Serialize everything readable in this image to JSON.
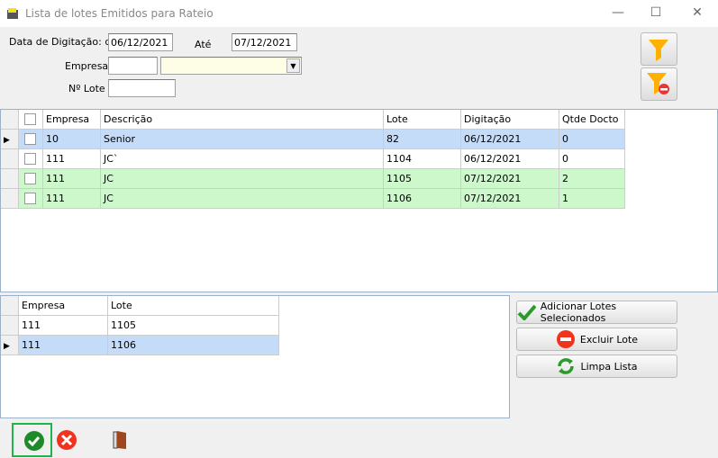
{
  "window": {
    "title": "Lista de lotes Emitidos para Rateio"
  },
  "filters": {
    "date_label": "Data de Digitação: de",
    "date_from": "06/12/2021",
    "ate_label": "Até",
    "date_to": "07/12/2021",
    "empresa_label": "Empresa",
    "empresa_code": "",
    "empresa_name": "",
    "lote_label": "Nº Lote",
    "lote_value": ""
  },
  "grid1": {
    "columns": [
      "Empresa",
      "Descrição",
      "Lote",
      "Digitação",
      "Qtde Docto"
    ],
    "rows": [
      {
        "empresa": "10",
        "descricao": "Senior",
        "lote": "82",
        "digitacao": "06/12/2021",
        "qtde": "0",
        "color": "#c5dcf8",
        "current": true
      },
      {
        "empresa": "111",
        "descricao": "JC`",
        "lote": "1104",
        "digitacao": "06/12/2021",
        "qtde": "0",
        "color": "#ffffff",
        "current": false
      },
      {
        "empresa": "111",
        "descricao": "JC",
        "lote": "1105",
        "digitacao": "07/12/2021",
        "qtde": "2",
        "color": "#ccf8cc",
        "current": false
      },
      {
        "empresa": "111",
        "descricao": "JC",
        "lote": "1106",
        "digitacao": "07/12/2021",
        "qtde": "1",
        "color": "#ccf8cc",
        "current": false
      }
    ]
  },
  "grid2": {
    "columns": [
      "Empresa",
      "Lote"
    ],
    "rows": [
      {
        "empresa": "111",
        "lote": "1105",
        "color": "#ffffff",
        "current": false
      },
      {
        "empresa": "111",
        "lote": "1106",
        "color": "#c5dcf8",
        "current": true
      }
    ]
  },
  "actions": {
    "add": "Adicionar Lotes Selecionados",
    "remove": "Excluir Lote",
    "clear": "Limpa Lista"
  }
}
